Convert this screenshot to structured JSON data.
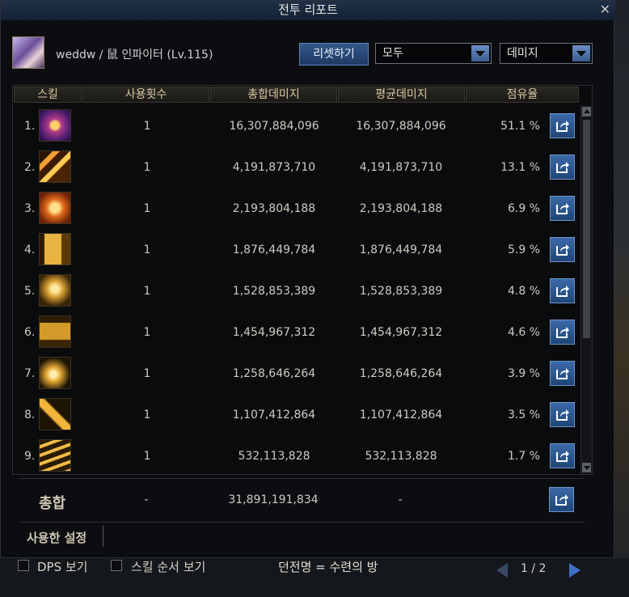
{
  "window": {
    "title": "전투 리포트",
    "close_glyph": "✕"
  },
  "character": {
    "name": "weddw / 鼠 인파이터 (Lv.115)"
  },
  "controls": {
    "reset_label": "리셋하기",
    "filter_value": "모두",
    "metric_value": "데미지"
  },
  "columns": [
    "스킬",
    "사용횟수",
    "총합데미지",
    "평균데미지",
    "점유율"
  ],
  "skills": [
    {
      "rank": "1.",
      "uses": "1",
      "total": "16,307,884,096",
      "avg": "16,307,884,096",
      "share": "51.1 %",
      "icon": "skill-icon-purple"
    },
    {
      "rank": "2.",
      "uses": "1",
      "total": "4,191,873,710",
      "avg": "4,191,873,710",
      "share": "13.1 %",
      "icon": "skill-icon-orange-slash"
    },
    {
      "rank": "3.",
      "uses": "1",
      "total": "2,193,804,188",
      "avg": "2,193,804,188",
      "share": "6.9 %",
      "icon": "skill-icon-fist"
    },
    {
      "rank": "4.",
      "uses": "1",
      "total": "1,876,449,784",
      "avg": "1,876,449,784",
      "share": "5.9 %",
      "icon": "skill-icon-gold-burst"
    },
    {
      "rank": "5.",
      "uses": "1",
      "total": "1,528,853,389",
      "avg": "1,528,853,389",
      "share": "4.8 %",
      "icon": "skill-icon-tiger"
    },
    {
      "rank": "6.",
      "uses": "1",
      "total": "1,454,967,312",
      "avg": "1,454,967,312",
      "share": "4.6 %",
      "icon": "skill-icon-punch"
    },
    {
      "rank": "7.",
      "uses": "1",
      "total": "1,258,646,264",
      "avg": "1,258,646,264",
      "share": "3.9 %",
      "icon": "skill-icon-spiral"
    },
    {
      "rank": "8.",
      "uses": "1",
      "total": "1,107,412,864",
      "avg": "1,107,412,864",
      "share": "3.5 %",
      "icon": "skill-icon-comet"
    },
    {
      "rank": "9.",
      "uses": "1",
      "total": "532,113,828",
      "avg": "532,113,828",
      "share": "1.7 %",
      "icon": "skill-icon-dash"
    }
  ],
  "total": {
    "label": "총합",
    "uses": "-",
    "sum": "31,891,191,834",
    "avg": "-"
  },
  "settings": {
    "label": "사용한 설정"
  },
  "footer": {
    "dps_label": "DPS 보기",
    "order_label": "스킬 순서 보기",
    "dungeon": "던전명 = 수련의 방",
    "page": "1 / 2"
  },
  "colors": {
    "accent": "#3f6fc4",
    "gold": "#d8c9a0",
    "panel": "#0b0d10"
  }
}
